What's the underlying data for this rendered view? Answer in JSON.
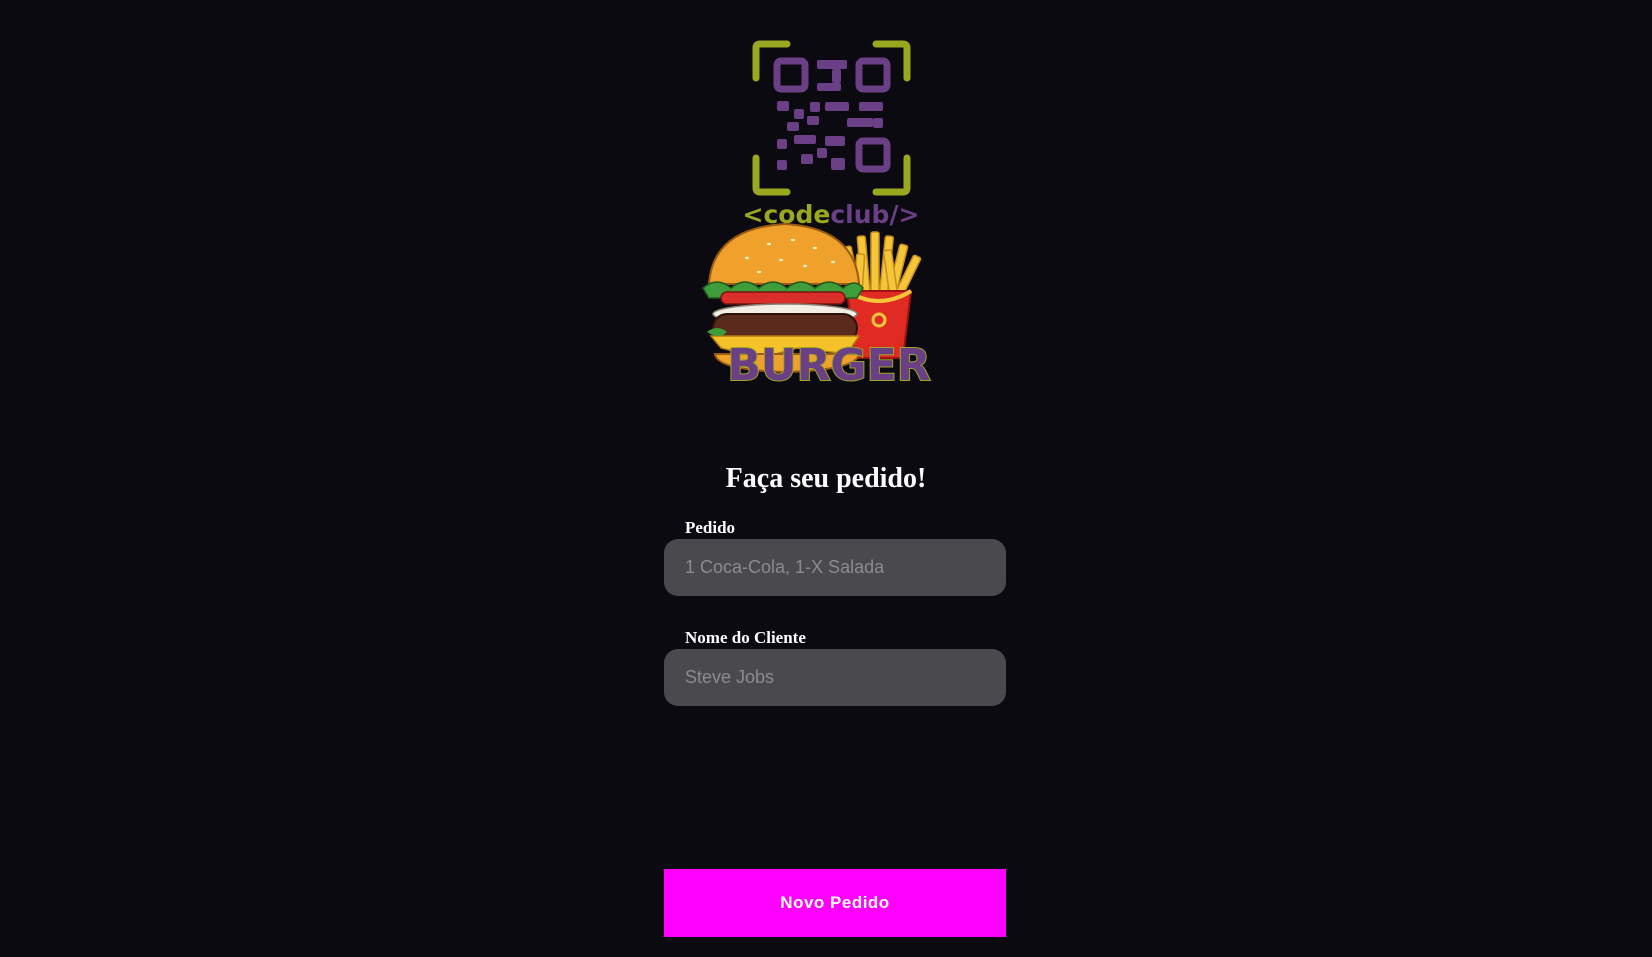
{
  "logo": {
    "code_open": "<",
    "code_word": "code",
    "club_word": "club",
    "code_close": "/>",
    "burger_word": "BURGER",
    "colors": {
      "olive": "#9aa820",
      "purple": "#6a3f85",
      "bun": "#f0a12b",
      "lettuce": "#3f9c3a",
      "tomato": "#d92e2a",
      "patty": "#5a2a1c",
      "cheese": "#f6c229",
      "fries": "#f5c53a",
      "fries_box": "#e02b22"
    }
  },
  "page": {
    "title": "Faça seu pedido!"
  },
  "form": {
    "order": {
      "label": "Pedido",
      "placeholder": "1 Coca-Cola, 1-X Salada",
      "value": ""
    },
    "customer": {
      "label": "Nome do Cliente",
      "placeholder": "Steve Jobs",
      "value": ""
    },
    "submit_label": "Novo Pedido"
  },
  "colors": {
    "background": "#0b0a10",
    "input_bg": "#4a494e",
    "accent": "#ff00ff",
    "text": "#ffffff"
  }
}
